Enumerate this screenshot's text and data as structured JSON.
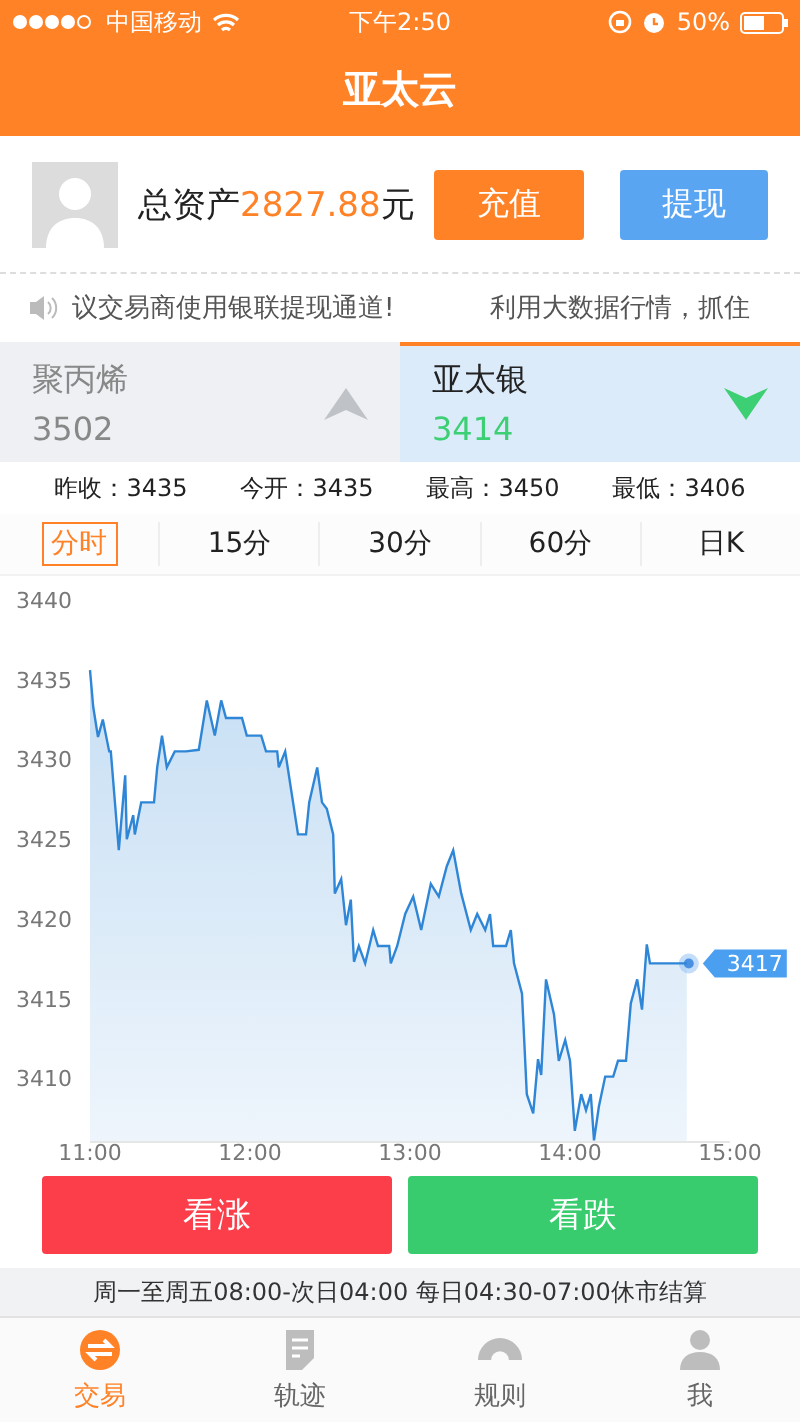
{
  "status_bar": {
    "carrier": "中国移动",
    "time": "下午2:50",
    "battery": "50%"
  },
  "header": {
    "title": "亚太云"
  },
  "account": {
    "label": "总资产",
    "amount": "2827.88",
    "unit": "元",
    "buttons": [
      {
        "label": "充值",
        "kind": "deposit"
      },
      {
        "label": "提现",
        "kind": "withdraw"
      }
    ]
  },
  "ticker": [
    "议交易商使用银联提现通道!",
    "利用大数据行情，抓住"
  ],
  "products": [
    {
      "name": "聚丙烯",
      "price": "3502",
      "kind": "up",
      "selected": false
    },
    {
      "name": "亚太银",
      "price": "3414",
      "kind": "down",
      "selected": true
    }
  ],
  "stats": [
    {
      "label": "昨收：",
      "value": "3435"
    },
    {
      "label": "今开：",
      "value": "3435"
    },
    {
      "label": "最高：",
      "value": "3450"
    },
    {
      "label": "最低：",
      "value": "3406"
    }
  ],
  "periods": [
    {
      "label": "分时",
      "selected": true
    },
    {
      "label": "15分",
      "selected": false
    },
    {
      "label": "30分",
      "selected": false
    },
    {
      "label": "60分",
      "selected": false
    },
    {
      "label": "日K",
      "selected": false
    }
  ],
  "chart": {
    "chart_data": {
      "type": "area",
      "x": [
        11,
        11.02,
        11.05,
        11.08,
        11.12,
        11.13,
        11.18,
        11.22,
        11.23,
        11.27,
        11.28,
        11.32,
        11.4,
        11.42,
        11.45,
        11.48,
        11.53,
        11.6,
        11.68,
        11.73,
        11.78,
        11.82,
        11.85,
        11.95,
        11.98,
        12.07,
        12.1,
        12.17,
        12.18,
        12.22,
        12.3,
        12.35,
        12.37,
        12.42,
        12.45,
        12.48,
        12.52,
        12.53,
        12.57,
        12.6,
        12.63,
        12.65,
        12.68,
        12.72,
        12.77,
        12.8,
        12.87,
        12.88,
        12.92,
        12.97,
        13.02,
        13.07,
        13.13,
        13.18,
        13.23,
        13.27,
        13.32,
        13.38,
        13.42,
        13.47,
        13.5,
        13.52,
        13.6,
        13.63,
        13.65,
        13.7,
        13.73,
        13.77,
        13.8,
        13.82,
        13.85,
        13.9,
        13.93,
        13.97,
        14,
        14.03,
        14.07,
        14.1,
        14.13,
        14.15,
        14.18,
        14.22,
        14.27,
        14.3,
        14.35,
        14.38,
        14.42,
        14.45,
        14.48,
        14.5,
        14.73
      ],
      "series": [
        {
          "color": "#2f86d6",
          "values": [
            3435.6,
            3433.3,
            3431.4,
            3432.5,
            3430.5,
            3430.5,
            3424.3,
            3429,
            3425,
            3426.5,
            3425.3,
            3427.3,
            3427.3,
            3429.5,
            3431.5,
            3429.5,
            3430.5,
            3430.5,
            3430.6,
            3433.7,
            3431.5,
            3433.7,
            3432.6,
            3432.6,
            3431.5,
            3431.5,
            3430.5,
            3430.5,
            3429.5,
            3430.5,
            3425.3,
            3425.3,
            3427.3,
            3429.5,
            3427.3,
            3426.9,
            3425.3,
            3421.6,
            3422.5,
            3419.6,
            3421.2,
            3417.3,
            3418.3,
            3417.2,
            3419.3,
            3418.3,
            3418.3,
            3417.2,
            3418.3,
            3420.3,
            3421.4,
            3419.3,
            3422.2,
            3421.4,
            3423.3,
            3424.3,
            3421.6,
            3419.3,
            3420.3,
            3419.3,
            3420.3,
            3418.3,
            3418.3,
            3419.3,
            3417.2,
            3415.3,
            3409,
            3407.8,
            3411.2,
            3410.2,
            3416.2,
            3414,
            3411.1,
            3412.4,
            3411.1,
            3406.7,
            3409,
            3408,
            3409,
            3406.1,
            3408.2,
            3410.1,
            3410.1,
            3411.1,
            3411.1,
            3414.7,
            3416.2,
            3414.3,
            3418.4,
            3417.2,
            3417.2
          ]
        }
      ],
      "xlim": [
        11,
        15
      ],
      "ylim": [
        3406,
        3440
      ],
      "xticks": [
        {
          "value": 11,
          "label": "11:00"
        },
        {
          "value": 12,
          "label": "12:00"
        },
        {
          "value": 13,
          "label": "13:00"
        },
        {
          "value": 14,
          "label": "14:00"
        },
        {
          "value": 15,
          "label": "15:00"
        }
      ],
      "yticks": [
        3410,
        3415,
        3420,
        3425,
        3430,
        3435,
        3440
      ],
      "annotations": [
        "3417"
      ]
    }
  },
  "trade_buttons": [
    {
      "label": "看涨",
      "kind": "rise"
    },
    {
      "label": "看跌",
      "kind": "fall"
    }
  ],
  "schedule": "周一至周五08:00-次日04:00 每日04:30-07:00休市结算",
  "nav": [
    {
      "label": "交易",
      "selected": true
    },
    {
      "label": "轨迹",
      "selected": false
    },
    {
      "label": "规则",
      "selected": false
    },
    {
      "label": "我",
      "selected": false
    }
  ]
}
